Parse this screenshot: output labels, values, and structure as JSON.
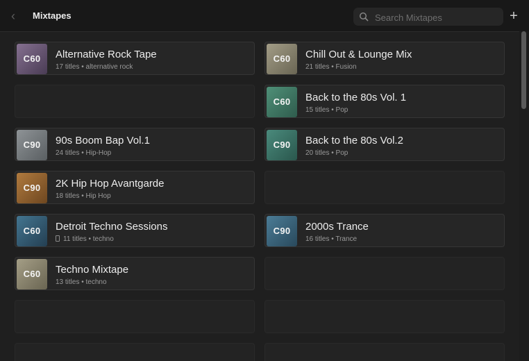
{
  "header": {
    "title": "Mixtapes",
    "search_placeholder": "Search Mixtapes"
  },
  "colors": {
    "c60_purple": "#6e5a78",
    "c60_sand": "#8c8672",
    "c60_teal": "#3f7865",
    "c90_gray": "#7a7f82",
    "c90_teal": "#3a7467",
    "c90_orange": "#9a6632",
    "c60_blue": "#35607a",
    "c90_blue": "#3d6a82"
  },
  "mixtapes": [
    {
      "badge": "C60",
      "title": "Alternative Rock Tape",
      "subtitle": "17 titles • alternative rock",
      "color": "c60_purple"
    },
    {
      "badge": "C60",
      "title": "Chill Out & Lounge Mix",
      "subtitle": "21 titles • Fusion",
      "color": "c60_sand"
    },
    {
      "badge": "C60",
      "title": "Back to the 80s Vol. 1",
      "subtitle": "15 titles • Pop",
      "color": "c60_teal"
    },
    {
      "badge": "C90",
      "title": "90s Boom Bap Vol.1",
      "subtitle": "24 titles • Hip-Hop",
      "color": "c90_gray"
    },
    {
      "badge": "C90",
      "title": "Back to the 80s Vol.2",
      "subtitle": "20 titles • Pop",
      "color": "c90_teal"
    },
    {
      "badge": "C90",
      "title": "2K Hip Hop Avantgarde",
      "subtitle": "18 titles • Hip Hop",
      "color": "c90_orange"
    },
    {
      "badge": "C60",
      "title": "Detroit Techno Sessions",
      "subtitle": "11 titles • techno",
      "color": "c60_blue",
      "device_icon": "phone-icon"
    },
    {
      "badge": "C90",
      "title": "2000s Trance",
      "subtitle": "16 titles • Trance",
      "color": "c90_blue"
    },
    {
      "badge": "C60",
      "title": "Techno Mixtape",
      "subtitle": "13 titles • techno",
      "color": "c60_sand"
    }
  ]
}
